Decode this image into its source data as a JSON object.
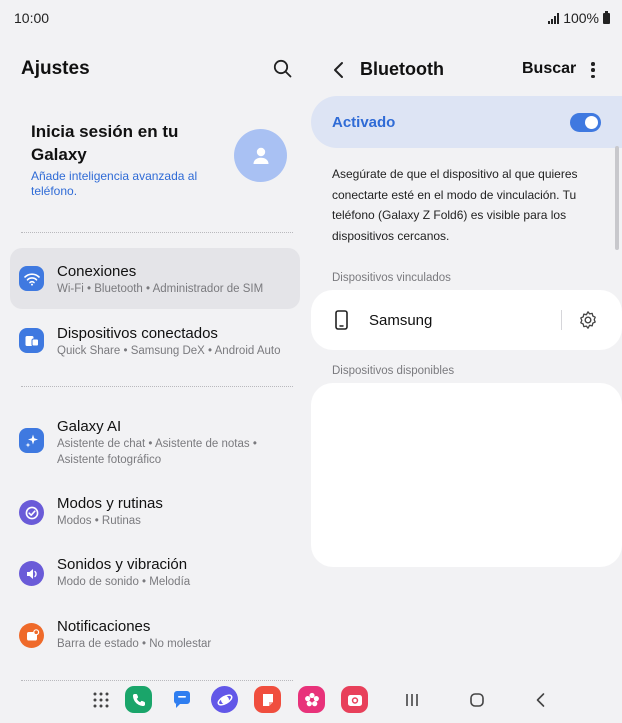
{
  "status_bar": {
    "time": "10:00",
    "battery": "100%"
  },
  "left": {
    "title": "Ajustes",
    "account": {
      "title": "Inicia sesión en tu Galaxy",
      "subtitle": "Añade inteligencia avanzada al teléfono."
    },
    "items": [
      {
        "title": "Conexiones",
        "subtitle": "Wi-Fi  •  Bluetooth  •  Administrador de SIM",
        "icon": "wifi-icon",
        "color": "#3f79e0",
        "active": true
      },
      {
        "title": "Dispositivos conectados",
        "subtitle": "Quick Share  •  Samsung DeX  •  Android Auto",
        "icon": "devices-icon",
        "color": "#3f79e0",
        "active": false
      },
      {
        "title": "Galaxy AI",
        "subtitle": "Asistente de chat  •  Asistente de notas  •  Asistente fotográfico",
        "icon": "sparkle-icon",
        "color": "#3f79e0",
        "active": false
      },
      {
        "title": "Modos y rutinas",
        "subtitle": "Modos  •  Rutinas",
        "icon": "check-circle-icon",
        "color": "#6a5bd8",
        "active": false
      },
      {
        "title": "Sonidos y vibración",
        "subtitle": "Modo de sonido  •  Melodía",
        "icon": "speaker-icon",
        "color": "#6a5bd8",
        "active": false
      },
      {
        "title": "Notificaciones",
        "subtitle": "Barra de estado  •  No molestar",
        "icon": "notification-icon",
        "color": "#ef6a2a",
        "active": false
      }
    ]
  },
  "right": {
    "title": "Bluetooth",
    "search_label": "Buscar",
    "toggle_label": "Activado",
    "toggle_on": true,
    "info": "Asegúrate de que el dispositivo al que quieres conectarte esté en el modo de vinculación. Tu teléfono (Galaxy Z Fold6) es visible para los dispositivos cercanos.",
    "paired_label": "Dispositivos vinculados",
    "paired_devices": [
      {
        "name": "Samsung",
        "icon": "phone-icon"
      }
    ],
    "available_label": "Dispositivos disponibles"
  },
  "dock": [
    {
      "name": "apps-grid-icon",
      "color": "#444444"
    },
    {
      "name": "phone-app-icon",
      "color": "#1aa56a"
    },
    {
      "name": "messages-app-icon",
      "color": "#2f7ef0"
    },
    {
      "name": "internet-app-icon",
      "color": "#6257e8"
    },
    {
      "name": "notes-app-icon",
      "color": "#f04e3e"
    },
    {
      "name": "gallery-app-icon",
      "color": "#e8327a"
    },
    {
      "name": "camera-app-icon",
      "color": "#e8405a"
    }
  ]
}
